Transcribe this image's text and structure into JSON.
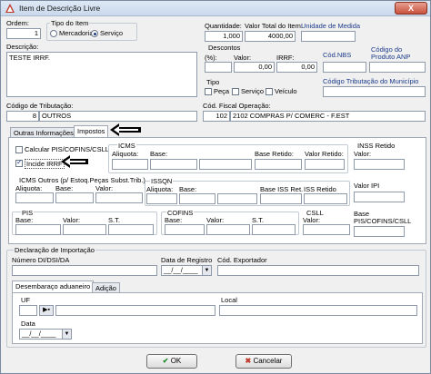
{
  "window": {
    "title": "Item de Descrição Livre",
    "close_glyph": "X"
  },
  "ordem": {
    "label": "Ordem:",
    "value": "1"
  },
  "tipo_item": {
    "label": "Tipo do Item",
    "options": [
      "Mercadoria",
      "Serviço"
    ],
    "selected": "Serviço"
  },
  "quantidade": {
    "label": "Quantidade:",
    "value": "1,000"
  },
  "valor_total": {
    "label": "Valor Total do Item:",
    "value": "4000,00"
  },
  "unidade_medida": {
    "label": "Unidade de Medida",
    "value": ""
  },
  "descricao": {
    "label": "Descrição:",
    "value": "TESTE IRRF."
  },
  "descontos": {
    "label": "Descontos",
    "pct_label": "(%):",
    "valor_label": "Valor:",
    "irrf_label": "IRRF:",
    "valor_value": "0,00",
    "irrf_value": "0,00"
  },
  "cod_nbs": {
    "label": "Cód.NBS",
    "value": ""
  },
  "cod_anp": {
    "label": "Código do Produto ANP",
    "value": ""
  },
  "tipo": {
    "label": "Tipo",
    "options": [
      "Peça",
      "Serviço",
      "Veículo"
    ]
  },
  "cod_trib_municipio": {
    "label": "Código Tributação do Município",
    "value": ""
  },
  "cod_tributacao": {
    "label": "Código de Tributação:",
    "code": "8",
    "value": "OUTROS"
  },
  "cod_fiscal": {
    "label": "Cód. Fiscal Operação:",
    "code": "102",
    "value": "2102 COMPRAS P/ COMERC - F.EST"
  },
  "tabs": {
    "outras": "Outras Informações",
    "impostos": "Impostos"
  },
  "impostos": {
    "calcular_pis": "Calcular PIS/COFINS/CSLL",
    "incide_irrf": "Incide IRRF",
    "icms": {
      "title": "ICMS",
      "aliquota": "Aliquota:",
      "base": "Base:",
      "base_retido": "Base Retido:",
      "valor_retido": "Valor Retido:"
    },
    "inss": {
      "title": "INSS Retido",
      "valor": "Valor:"
    },
    "icms_outros": {
      "title": "ICMS Outros (p/ Estoq.Peças Subst.Trib.)",
      "aliquota": "Aliquota:",
      "base": "Base:",
      "valor": "Valor:"
    },
    "issqn": {
      "title": "ISSQN",
      "aliquota": "Aliquota:",
      "base": "Base:",
      "base_iss_ret": "Base ISS Ret.",
      "iss_retido": "ISS Retido"
    },
    "ipi": {
      "title": "Valor IPI"
    },
    "pis": {
      "title": "PIS",
      "base": "Base:",
      "valor": "Valor:",
      "st": "S.T."
    },
    "cofins": {
      "title": "COFINS",
      "base": "Base:",
      "valor": "Valor:",
      "st": "S.T."
    },
    "csll": {
      "title": "CSLL",
      "valor": "Valor:"
    },
    "base_pis": {
      "title": "Base PIS/COFINS/CSLL"
    }
  },
  "importacao": {
    "section": "Declaração de Importação",
    "numero_label": "Número DI/DSI/DA",
    "data_registro_label": "Data de Registro",
    "data_registro_value": "__/__/____",
    "cod_exportador_label": "Cód. Exportador",
    "tab_desembaraco": "Desembaraço aduaneiro",
    "tab_adicao": "Adição",
    "uf_label": "UF",
    "local_label": "Local",
    "data_label": "Data",
    "data_value": "__/__/____"
  },
  "buttons": {
    "ok": "OK",
    "cancel": "Cancelar"
  }
}
